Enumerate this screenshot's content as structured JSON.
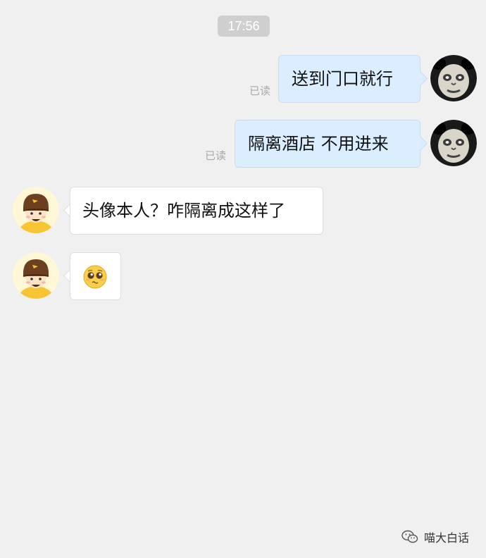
{
  "timestamp": "17:56",
  "messages": [
    {
      "direction": "outgoing",
      "text": "送到门口就行",
      "status": "已读",
      "avatar": "panda-meme-avatar"
    },
    {
      "direction": "outgoing",
      "text": "隔离酒店 不用进来",
      "status": "已读",
      "avatar": "panda-meme-avatar"
    },
    {
      "direction": "incoming",
      "text": "头像本人？咋隔离成这样了",
      "avatar": "delivery-rider-avatar"
    },
    {
      "direction": "incoming",
      "emoji": "pleading-face-emoji",
      "avatar": "delivery-rider-avatar"
    }
  ],
  "watermark": {
    "icon": "wechat-icon",
    "text": "喵大白话"
  },
  "colors": {
    "background": "#f0f0f0",
    "outgoing_bubble": "#dbeeff",
    "incoming_bubble": "#ffffff",
    "timestamp_pill": "#cfcfcf"
  }
}
